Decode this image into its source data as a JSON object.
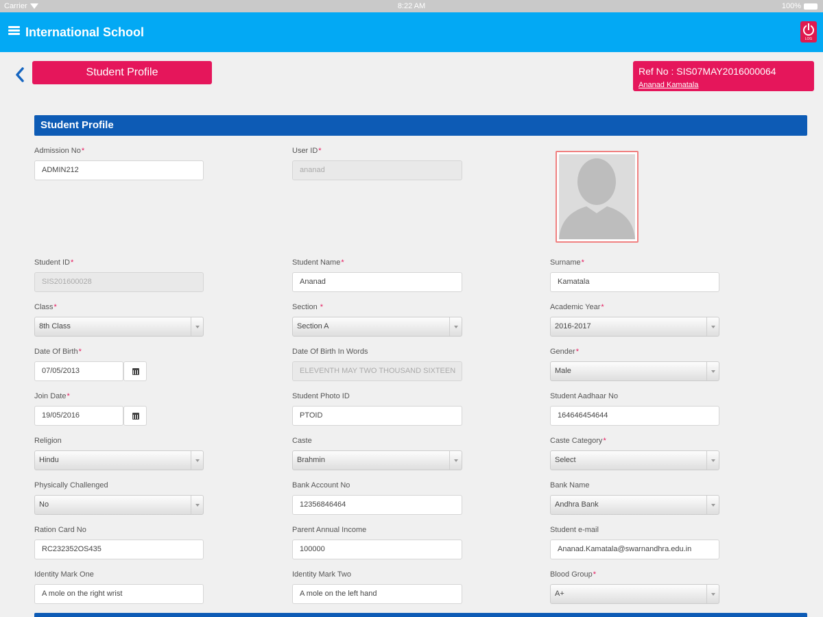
{
  "status_bar": {
    "carrier": "Carrier",
    "time": "8:22 AM",
    "battery": "100%"
  },
  "app": {
    "title": "International School",
    "logout_caption": "LOG"
  },
  "page": {
    "title_button": "Student Profile",
    "ref_no": "Ref No : SIS07MAY2016000064",
    "ref_name": "Ananad Kamatala"
  },
  "section": {
    "title": "Student Profile"
  },
  "fields": {
    "admission_no": {
      "label": "Admission No",
      "value": "ADMIN212"
    },
    "user_id": {
      "label": "User ID",
      "value": "ananad"
    },
    "student_id": {
      "label": "Student ID",
      "value": "SIS201600028"
    },
    "student_name": {
      "label": "Student Name",
      "value": "Ananad"
    },
    "surname": {
      "label": "Surname",
      "value": "Kamatala"
    },
    "class": {
      "label": "Class",
      "value": "8th Class"
    },
    "section": {
      "label": "Section ",
      "value": "Section A"
    },
    "academic_year": {
      "label": "Academic Year",
      "value": "2016-2017"
    },
    "dob": {
      "label": "Date Of Birth",
      "value": "07/05/2013"
    },
    "dob_words": {
      "label": "Date Of Birth In Words",
      "value": "ELEVENTH MAY TWO THOUSAND SIXTEEN"
    },
    "gender": {
      "label": "Gender",
      "value": "Male"
    },
    "join_date": {
      "label": "Join Date",
      "value": "19/05/2016"
    },
    "photo_id": {
      "label": "Student Photo ID",
      "value": "PTOID"
    },
    "aadhaar": {
      "label": "Student Aadhaar No",
      "value": "164646454644"
    },
    "religion": {
      "label": "Religion",
      "value": "Hindu"
    },
    "caste": {
      "label": "Caste",
      "value": "Brahmin"
    },
    "caste_category": {
      "label": "Caste Category",
      "value": "Select"
    },
    "physically_challenged": {
      "label": "Physically Challenged",
      "value": "No"
    },
    "bank_account": {
      "label": "Bank Account No",
      "value": "12356846464"
    },
    "bank_name": {
      "label": "Bank Name",
      "value": "Andhra Bank"
    },
    "ration_card": {
      "label": "Ration Card No",
      "value": "RC232352OS435"
    },
    "annual_income": {
      "label": "Parent Annual Income",
      "value": "100000"
    },
    "email": {
      "label": "Student e-mail",
      "value": "Ananad.Kamatala@swarnandhra.edu.in"
    },
    "mark_one": {
      "label": "Identity Mark One",
      "value": "A mole on the right wrist"
    },
    "mark_two": {
      "label": "Identity Mark Two",
      "value": "A mole on the left hand"
    },
    "blood_group": {
      "label": "Blood Group",
      "value": "A+"
    }
  },
  "colors": {
    "appbar": "#03a9f4",
    "accent": "#e5165b",
    "section": "#0d5bb5"
  }
}
